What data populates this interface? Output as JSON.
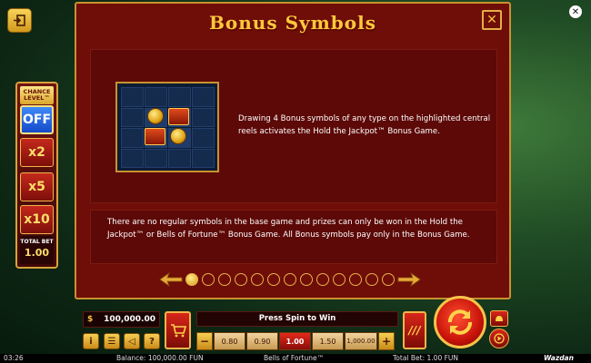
{
  "modal": {
    "title": "Bonus Symbols",
    "close_label": "✕",
    "description_top": "Drawing 4 Bonus symbols of any type on the highlighted central reels activates the Hold the Jackpot™ Bonus Game.",
    "description_bottom": "There are no regular symbols in the base game and prizes can only be won in the Hold the Jackpot™ or Bells of Fortune™ Bonus Game. All Bonus symbols pay only in the Bonus Game.",
    "page_count": 13,
    "active_page": 1
  },
  "chance_level": {
    "title": "CHANCE LEVEL™",
    "options": [
      "OFF",
      "x2",
      "x5",
      "x10"
    ],
    "active": "OFF",
    "total_bet_label": "TOTAL BET",
    "total_bet_value": "1.00"
  },
  "controls": {
    "balance": "100,000.00",
    "message": "Press Spin to Win",
    "bet_options": [
      "0.80",
      "0.90",
      "1.00",
      "1.50",
      "1,000.00"
    ],
    "active_bet": "1.00",
    "minus": "−",
    "plus": "+",
    "info": "i",
    "menu": "☰",
    "sound": "◁",
    "help": "?"
  },
  "status": {
    "time": "03:26",
    "balance": "Balance: 100,000.00 FUN",
    "game": "Bells of Fortune™",
    "total_bet": "Total Bet: 1.00 FUN",
    "logo": "Wazdan"
  },
  "colors": {
    "gold": "#ffc93b",
    "modal_bg": "#6f0d08",
    "active_blue": "#1f5fe0"
  },
  "icons": [
    "exit-icon",
    "close-icon",
    "cart-icon",
    "lightning-icon",
    "spin-arrows-icon",
    "autoplay-icon"
  ]
}
